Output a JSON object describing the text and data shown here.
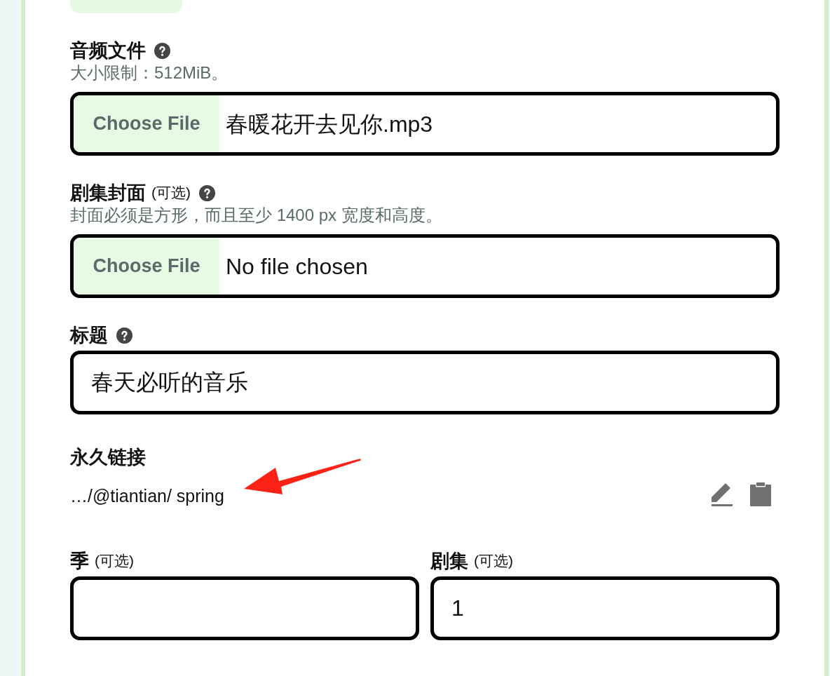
{
  "fields": [
    {
      "kind": "file",
      "label": "音频文件",
      "help": true,
      "hint": "大小限制：512MiB。",
      "button": "Choose File",
      "status": "春暖花开去见你.mp3"
    },
    {
      "kind": "file",
      "label": "剧集封面",
      "optional": "(可选)",
      "help": true,
      "hint": "封面必须是方形，而且至少 1400 px 宽度和高度。",
      "button": "Choose File",
      "status": "No file chosen"
    },
    {
      "kind": "text",
      "label": "标题",
      "help": true,
      "value": "春天必听的音乐"
    },
    {
      "kind": "permalink",
      "label": "永久链接",
      "help": false,
      "value": "…/@tiantian/ spring",
      "annotation": {
        "kind": "arrow"
      }
    },
    {
      "kind": "pair",
      "items": [
        {
          "label": "季",
          "optional": "(可选)",
          "help": false
        },
        {
          "label": "剧集",
          "optional": "(可选)",
          "help": false,
          "value": "1"
        }
      ]
    }
  ]
}
